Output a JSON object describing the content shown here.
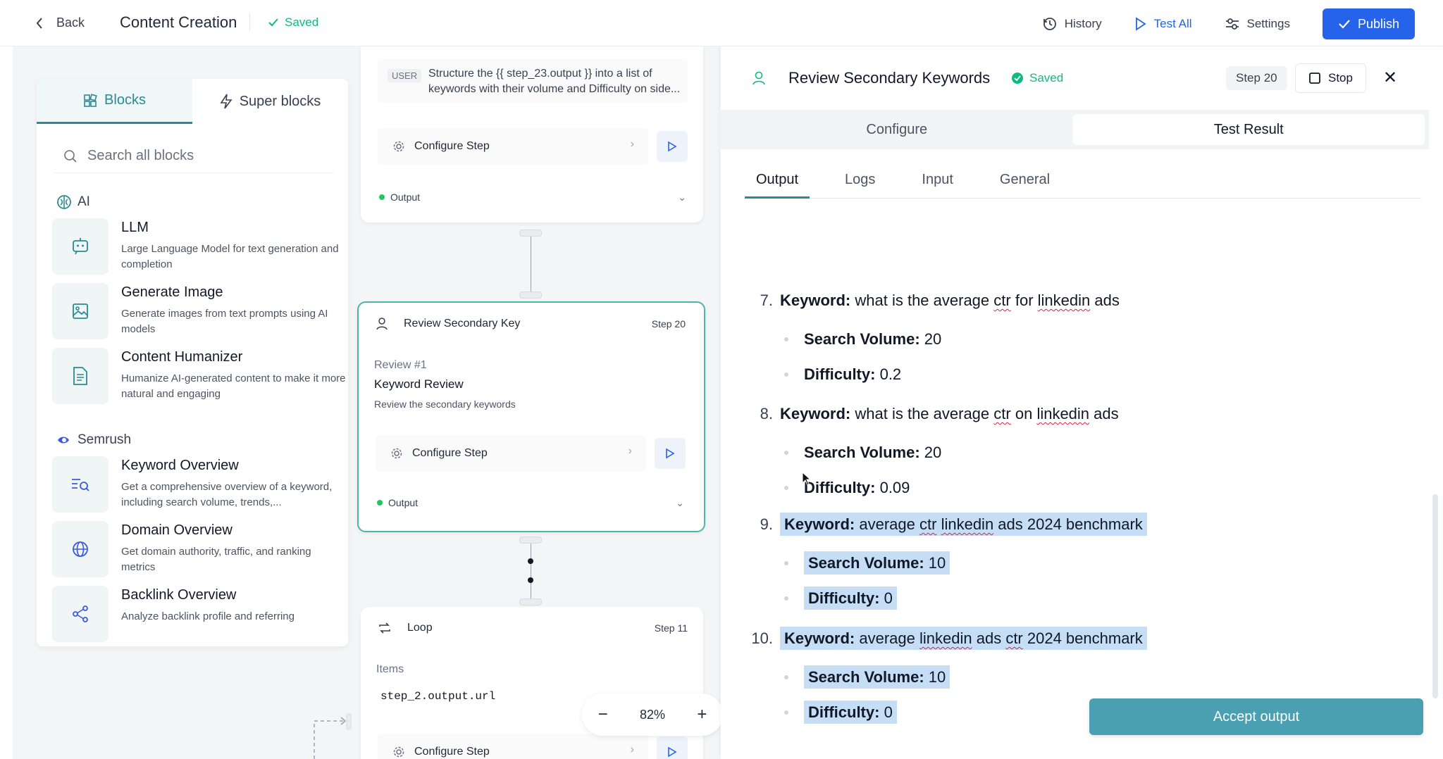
{
  "topbar": {
    "back_label": "Back",
    "title": "Content Creation",
    "saved_label": "Saved",
    "history_label": "History",
    "test_all_label": "Test All",
    "settings_label": "Settings",
    "publish_label": "Publish"
  },
  "blocks_panel": {
    "tabs": [
      "Blocks",
      "Super blocks"
    ],
    "search_placeholder": "Search all blocks",
    "sections": [
      {
        "label": "AI",
        "items": [
          {
            "title": "LLM",
            "desc": "Large Language Model for text generation and completion",
            "icon": "chat-bot-icon"
          },
          {
            "title": "Generate Image",
            "desc": "Generate images from text prompts using AI models",
            "icon": "image-icon"
          },
          {
            "title": "Content Humanizer",
            "desc": "Humanize AI-generated content to make it more natural and engaging",
            "icon": "document-icon"
          }
        ]
      },
      {
        "label": "Semrush",
        "items": [
          {
            "title": "Keyword Overview",
            "desc": "Get a comprehensive overview of a keyword, including search volume, trends,...",
            "icon": "keyword-search-icon"
          },
          {
            "title": "Domain Overview",
            "desc": "Get domain authority, traffic, and ranking metrics",
            "icon": "globe-icon"
          },
          {
            "title": "Backlink Overview",
            "desc": "Analyze backlink profile and referring",
            "icon": "share-icon"
          }
        ]
      }
    ]
  },
  "flow": {
    "node_a": {
      "user_badge": "USER",
      "user_text": "Structure the {{ step_23.output }} into a list of keywords with their volume and Difficulty on side...",
      "configure_label": "Configure Step",
      "output_label": "Output"
    },
    "node_b": {
      "title": "Review Secondary Key",
      "step": "Step 20",
      "review_num": "Review #1",
      "review_title": "Keyword Review",
      "review_desc": "Review the secondary keywords",
      "configure_label": "Configure Step",
      "output_label": "Output"
    },
    "node_c": {
      "title": "Loop",
      "step": "Step 11",
      "items_label": "Items",
      "items_value": "step_2.output.url",
      "configure_label": "Configure Step"
    },
    "zoom_label": "82%"
  },
  "right_panel": {
    "title": "Review Secondary Keywords",
    "saved_label": "Saved",
    "step_label": "Step 20",
    "stop_label": "Stop",
    "segments": [
      "Configure",
      "Test Result"
    ],
    "tabs": [
      "Output",
      "Logs",
      "Input",
      "General"
    ],
    "keywords": [
      {
        "num": "7.",
        "kw_label": "Keyword:",
        "kw_pre": "what is the average ",
        "kw_ctr": "ctr",
        "kw_mid": " for ",
        "kw_li": "linkedin",
        "kw_post": " ads",
        "sv_label": "Search Volume:",
        "sv": "20",
        "diff_label": "Difficulty:",
        "diff": "0.2"
      },
      {
        "num": "8.",
        "kw_label": "Keyword:",
        "kw_pre": "what is the average ",
        "kw_ctr": "ctr",
        "kw_mid": " on ",
        "kw_li": "linkedin",
        "kw_post": " ads",
        "sv_label": "Search Volume:",
        "sv": "20",
        "diff_label": "Difficulty:",
        "diff": "0.09"
      },
      {
        "num": "9.",
        "kw_label": "Keyword:",
        "kw_pre": "average ",
        "kw_ctr": "ctr",
        "kw_mid": " ",
        "kw_li": "linkedin",
        "kw_post": " ads 2024 benchmark",
        "sv_label": "Search Volume:",
        "sv": "10",
        "diff_label": "Difficulty:",
        "diff": "0"
      },
      {
        "num": "10.",
        "kw_label": "Keyword:",
        "kw_pre": "average ",
        "kw_ctr": "linkedin",
        "kw_mid": " ads ",
        "kw_li": "ctr",
        "kw_post": " 2024 benchmark",
        "sv_label": "Search Volume:",
        "sv": "10",
        "diff_label": "Difficulty:",
        "diff": "0"
      }
    ],
    "accept_label": "Accept output"
  },
  "colors": {
    "accent_teal": "#2a8a95",
    "primary_blue": "#2563eb",
    "saved_green": "#10b981",
    "highlight": "#c5def5",
    "accept_button": "#4a9fb0"
  }
}
